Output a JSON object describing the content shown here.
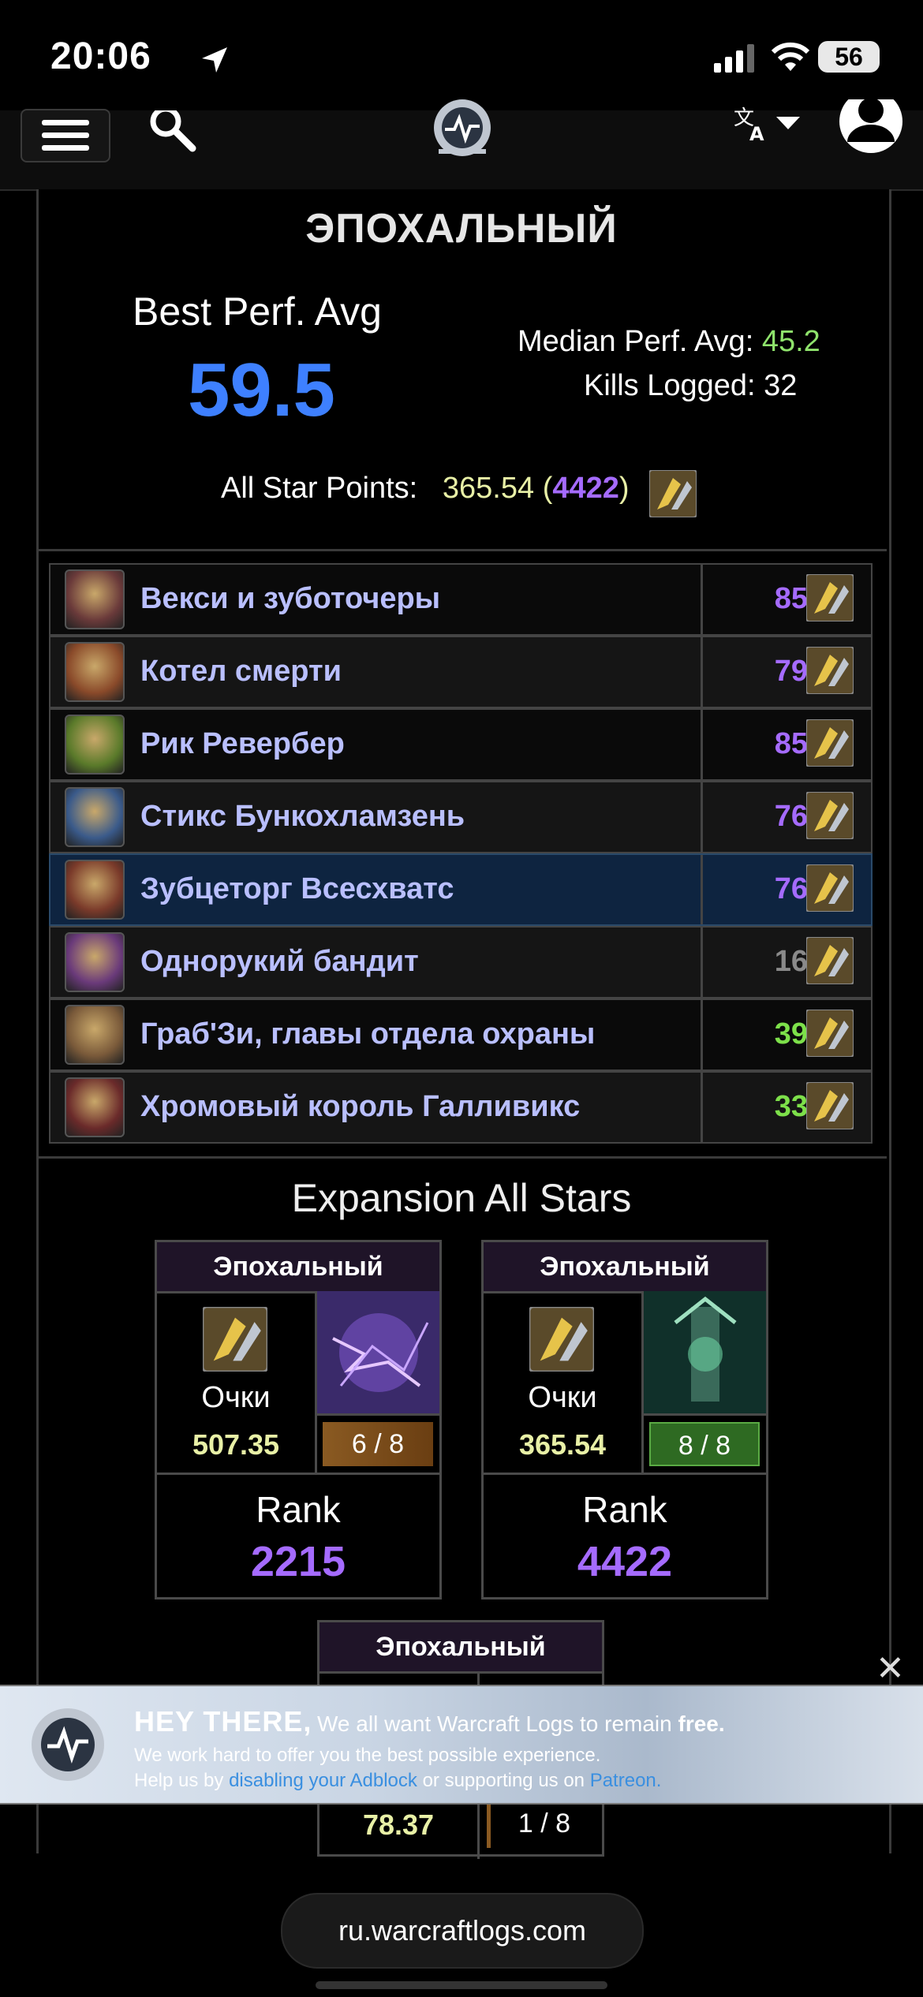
{
  "status_bar": {
    "time": "20:06",
    "battery": "56"
  },
  "nav": {
    "lang_icon": "translate-icon",
    "user_icon": "user-avatar-icon"
  },
  "summary": {
    "difficulty": "ЭПОХАЛЬНЫЙ",
    "best_perf_label": "Best Perf. Avg",
    "best_perf_value": "59.5",
    "median_label": "Median Perf. Avg:",
    "median_value": "45.2",
    "kills_label": "Kills Logged:",
    "kills_value": "32",
    "all_star_label": "All Star Points:",
    "all_star_points": "365.54",
    "all_star_rank": "4422",
    "rank_colors": {
      "legendary_purple": "#a56bff",
      "blue": "#3e80ff",
      "green": "#8fe36c"
    }
  },
  "bosses": [
    {
      "name": "Векси и зуботочеры",
      "score": "85",
      "color": "#a56bff",
      "highlight": false
    },
    {
      "name": "Котел смерти",
      "score": "79",
      "color": "#a56bff",
      "highlight": false
    },
    {
      "name": "Рик Ревербер",
      "score": "85",
      "color": "#a56bff",
      "highlight": false
    },
    {
      "name": "Стикс Бункохламзень",
      "score": "76",
      "color": "#a56bff",
      "highlight": false
    },
    {
      "name": "Зубцеторг Всесхватс",
      "score": "76",
      "color": "#a56bff",
      "highlight": true
    },
    {
      "name": "Однорукий бандит",
      "score": "16",
      "color": "#8a8a8a",
      "highlight": false
    },
    {
      "name": "Граб'Зи, главы отдела охраны",
      "score": "39",
      "color": "#7de04a",
      "highlight": false
    },
    {
      "name": "Хромовый король Галливикс",
      "score": "33",
      "color": "#7de04a",
      "highlight": false
    }
  ],
  "expansion": {
    "title": "Expansion All Stars",
    "cards": [
      {
        "header": "Эпохальный",
        "points_label": "Очки",
        "points": "507.35",
        "progress": "6 / 8",
        "rank_label": "Rank",
        "rank": "2215"
      },
      {
        "header": "Эпохальный",
        "points_label": "Очки",
        "points": "365.54",
        "progress": "8 / 8",
        "rank_label": "Rank",
        "rank": "4422"
      },
      {
        "header": "Эпохальный",
        "points": "78.37",
        "progress": "1 / 8"
      }
    ]
  },
  "ad": {
    "heading": "HEY THERE,",
    "line1_prefix": "We all want Warcraft Logs to remain",
    "line1_bold": "free.",
    "line2": "We work hard to offer you the best possible experience.",
    "line3_prefix": "Help us by",
    "line3_link1": "disabling your Adblock",
    "line3_mid": "or supporting us on",
    "line3_link2": "Patreon."
  },
  "url_bar": {
    "domain": "ru.warcraftlogs.com"
  }
}
